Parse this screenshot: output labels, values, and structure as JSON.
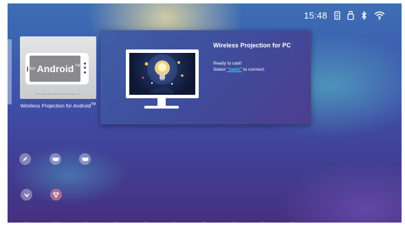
{
  "status_bar": {
    "time": "15:48",
    "icons": [
      "sd-card-icon",
      "usb-icon",
      "bluetooth-icon",
      "wifi-icon"
    ]
  },
  "android_tile": {
    "brand_prefix": "for",
    "brand": "Android",
    "brand_mark": "TM",
    "trademark_line": "Android is a trademark of Google LLC",
    "label": "Wireless Projection for Android",
    "label_mark": "TM"
  },
  "pc_panel": {
    "title": "Wireless Projection for PC",
    "message_line1": "Ready to cast!",
    "message_prefix": "Select ",
    "device_name": "\"swe1\"",
    "message_suffix": " to connect."
  },
  "colors": {
    "panel_bg": "#3f4d9c",
    "link_accent": "#34d2ff"
  },
  "source_icons": [
    "pen-icon",
    "hdmi1-icon",
    "hdmi2-icon",
    "usb-media-icon",
    "widget-icon"
  ]
}
